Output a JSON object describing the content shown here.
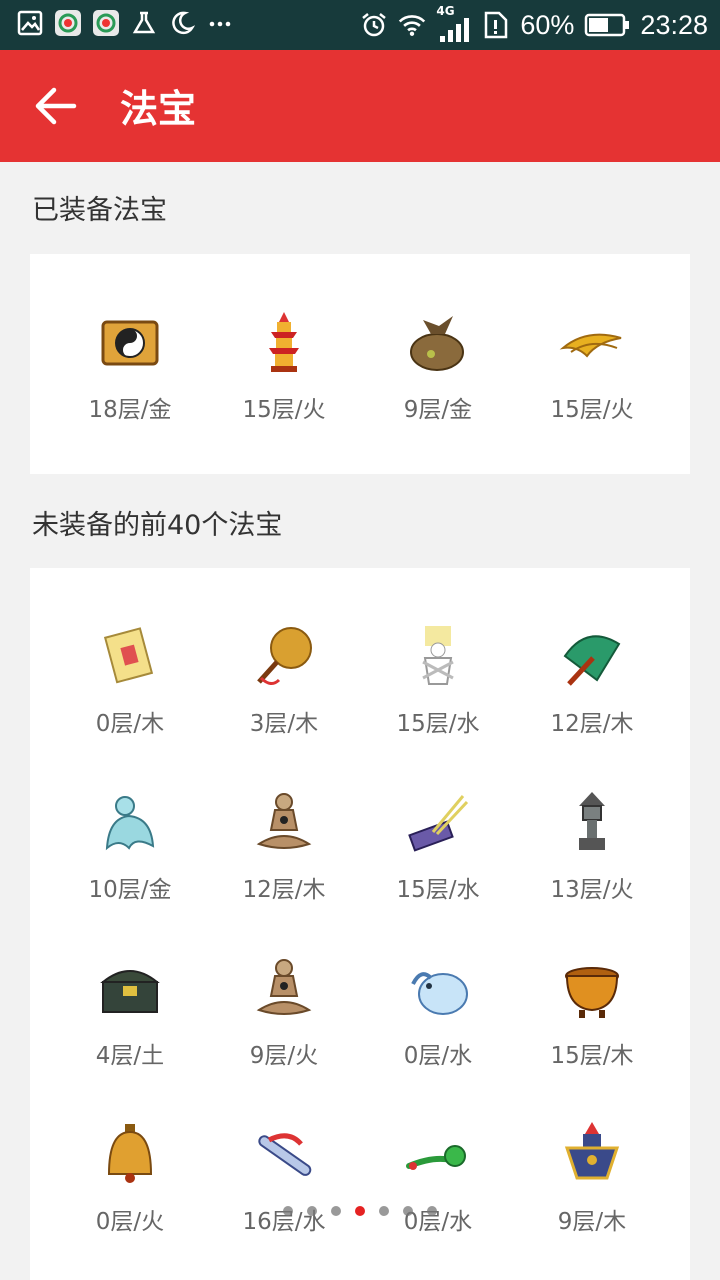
{
  "status_bar": {
    "battery": "60%",
    "time": "23:28",
    "network": "4G"
  },
  "app_bar": {
    "title": "法宝"
  },
  "equipped": {
    "section_title": "已装备法宝",
    "items": [
      {
        "label": "18层/金",
        "icon": "yin-yang-scroll-icon"
      },
      {
        "label": "15层/火",
        "icon": "pagoda-icon"
      },
      {
        "label": "9层/金",
        "icon": "pouch-icon"
      },
      {
        "label": "15层/火",
        "icon": "golden-wing-icon"
      }
    ]
  },
  "unequipped": {
    "section_title": "未装备的前40个法宝",
    "items": [
      {
        "label": "0层/木",
        "icon": "scroll-icon"
      },
      {
        "label": "3层/木",
        "icon": "palm-fan-icon"
      },
      {
        "label": "15层/水",
        "icon": "paper-doll-icon"
      },
      {
        "label": "12层/木",
        "icon": "umbrella-icon"
      },
      {
        "label": "10层/金",
        "icon": "jade-figure-icon"
      },
      {
        "label": "12层/木",
        "icon": "meditating-doll-icon"
      },
      {
        "label": "15层/水",
        "icon": "brush-box-icon"
      },
      {
        "label": "13层/火",
        "icon": "stone-lantern-icon"
      },
      {
        "label": "4层/土",
        "icon": "treasure-chest-icon"
      },
      {
        "label": "9层/火",
        "icon": "meditating-doll-icon"
      },
      {
        "label": "0层/水",
        "icon": "ice-beast-icon"
      },
      {
        "label": "15层/木",
        "icon": "golden-cauldron-icon"
      },
      {
        "label": "0层/火",
        "icon": "bell-icon"
      },
      {
        "label": "16层/水",
        "icon": "flute-icon"
      },
      {
        "label": "0层/水",
        "icon": "jade-ruyi-icon"
      },
      {
        "label": "9层/木",
        "icon": "armor-figure-icon"
      }
    ]
  },
  "pager": {
    "count": 7,
    "active": 3
  }
}
